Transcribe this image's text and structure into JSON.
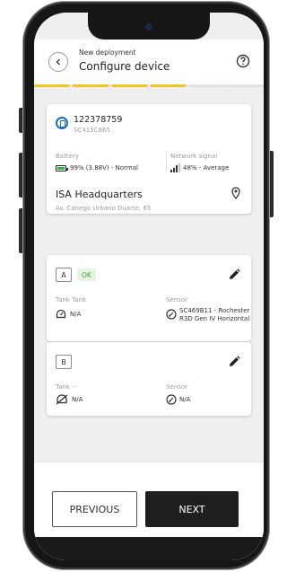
{
  "header": {
    "subtitle": "New deployment",
    "title": "Configure device",
    "steps_total": 6,
    "steps_done": 4
  },
  "device": {
    "id": "122378759",
    "serial": "SC415C665",
    "battery_label": "Battery",
    "battery_value": "99% (3.88V) - Normal",
    "network_label": "Network signal",
    "network_value": "48% - Average"
  },
  "location": {
    "name": "ISA Headquarters",
    "address": "Av. Cónego Urbano Duarte, 65"
  },
  "slots": [
    {
      "letter": "A",
      "status": "OK",
      "tank_label": "Tank Tank",
      "tank_value": "N/A",
      "sensor_label": "Sensor",
      "sensor_value_line1": "SC469B11 - Rochester",
      "sensor_value_line2": "R3D Gen IV Horizontal"
    },
    {
      "letter": "B",
      "tank_label": "Tank --",
      "tank_value": "N/A",
      "sensor_label": "Sensor",
      "sensor_value": "N/A"
    }
  ],
  "footer": {
    "previous_label": "PREVIOUS",
    "next_label": "NEXT"
  },
  "colors": {
    "accent": "#f2c521",
    "ok_green": "#3aa53a",
    "battery_green": "#2fb54c",
    "device_blue": "#1d6fb8"
  },
  "icons": [
    "back-arrow-icon",
    "help-icon",
    "device-icon",
    "battery-icon",
    "signal-icon",
    "location-pin-icon",
    "pencil-icon",
    "tank-icon",
    "tank-disabled-icon",
    "sensor-icon"
  ]
}
